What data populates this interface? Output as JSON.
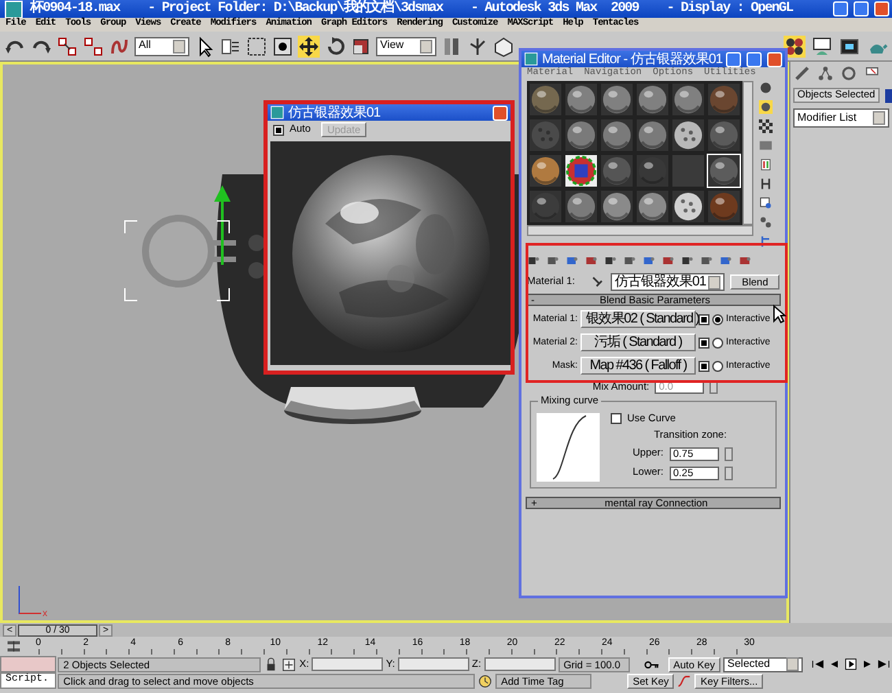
{
  "window": {
    "title": "杯0904-18.max    - Project Folder: D:\\Backup\\我的文档\\3dsmax    - Autodesk 3ds Max  2009    - Display : OpenGL"
  },
  "menu": [
    "File",
    "Edit",
    "Tools",
    "Group",
    "Views",
    "Create",
    "Modifiers",
    "Animation",
    "Graph Editors",
    "Rendering",
    "Customize",
    "MAXScript",
    "Help",
    "Tentacles"
  ],
  "toolbar": {
    "selection_filter": "All",
    "reference_coord": "View"
  },
  "viewport": {
    "axis_label": "x"
  },
  "command_panel": {
    "selection_field": "Objects Selected",
    "modifier_list": "Modifier List"
  },
  "preview": {
    "title": "仿古银器效果01",
    "auto_label": "Auto",
    "auto": true,
    "update": "Update",
    "update_disabled": true
  },
  "material_editor": {
    "title": "Material Editor - 仿古银器效果01",
    "menu": [
      "Material",
      "Navigation",
      "Options",
      "Utilities"
    ],
    "slots": [
      {
        "kind": "sphere",
        "color": "#75684f",
        "selected": false
      },
      {
        "kind": "sphere",
        "color": "#808080",
        "selected": false
      },
      {
        "kind": "sphere",
        "color": "#808080",
        "selected": false
      },
      {
        "kind": "sphere",
        "color": "#808080",
        "selected": false
      },
      {
        "kind": "sphere",
        "color": "#808080",
        "selected": false
      },
      {
        "kind": "sphere",
        "color": "#6a4630",
        "selected": false
      },
      {
        "kind": "pattern",
        "color": "#4a4a4a",
        "selected": false
      },
      {
        "kind": "sphere",
        "color": "#7a7a7a",
        "selected": false
      },
      {
        "kind": "sphere",
        "color": "#7a7a7a",
        "selected": false
      },
      {
        "kind": "sphere",
        "color": "#7a7a7a",
        "selected": false
      },
      {
        "kind": "pattern",
        "color": "#b8b8b8",
        "selected": false
      },
      {
        "kind": "sphere",
        "color": "#5a5a5a",
        "selected": false
      },
      {
        "kind": "sphere",
        "color": "#b07a40",
        "selected": false
      },
      {
        "kind": "multicolor",
        "color": "#c83030",
        "selected": false
      },
      {
        "kind": "sphere",
        "color": "#555555",
        "selected": false
      },
      {
        "kind": "sphere",
        "color": "#383838",
        "selected": false
      },
      {
        "kind": "flat",
        "color": "#3a3a3a",
        "selected": false
      },
      {
        "kind": "sphere",
        "color": "#5c5c5c",
        "selected": true
      },
      {
        "kind": "sphere",
        "color": "#3c3c3c",
        "selected": false
      },
      {
        "kind": "sphere",
        "color": "#7a7a7a",
        "selected": false
      },
      {
        "kind": "sphere",
        "color": "#8a8a8a",
        "selected": false
      },
      {
        "kind": "sphere",
        "color": "#8a8a8a",
        "selected": false
      },
      {
        "kind": "pattern",
        "color": "#d0d0d0",
        "selected": false
      },
      {
        "kind": "sphere",
        "color": "#6e3a1e",
        "selected": false
      }
    ],
    "material_label": "Material 1:",
    "material_name": "仿古银器效果01",
    "type_button": "Blend",
    "rollout": {
      "toggle": "-",
      "title": "Blend Basic Parameters",
      "rows": [
        {
          "label": "Material 1:",
          "value": "银效果02  ( Standard )",
          "enabled": true,
          "interactive": true,
          "interactive_label": "Interactive"
        },
        {
          "label": "Material 2:",
          "value": "污垢  ( Standard )",
          "enabled": true,
          "interactive": false,
          "interactive_label": "Interactive"
        },
        {
          "label": "Mask:",
          "value": "Map #436  ( Falloff )",
          "enabled": true,
          "interactive": false,
          "interactive_label": "Interactive"
        }
      ],
      "mix_amount_label": "Mix Amount:",
      "mix_amount": "0.0"
    },
    "mixing_curve": {
      "title": "Mixing curve",
      "use_curve_label": "Use Curve",
      "use_curve": false,
      "transition_label": "Transition zone:",
      "upper_label": "Upper:",
      "upper": "0.75",
      "lower_label": "Lower:",
      "lower": "0.25"
    },
    "rollout_2": {
      "toggle": "+",
      "title": "mental ray Connection"
    }
  },
  "timeline": {
    "prev": "<",
    "position": "0 / 30",
    "level": 0,
    "next": ">",
    "ticks": [
      "0",
      "2",
      "4",
      "6",
      "8",
      "10",
      "12",
      "14",
      "16",
      "18",
      "20",
      "22",
      "24",
      "26",
      "28",
      "30"
    ]
  },
  "status": {
    "listener": "Script.",
    "selection": "2 Objects Selected",
    "prompt": "Click and drag to select and move objects",
    "x_label": "X:",
    "y_label": "Y:",
    "z_label": "Z:",
    "grid": "Grid = 100.0",
    "time_tag": "Add Time Tag",
    "auto_key": "Auto Key",
    "key_mode": "Selected",
    "set_key": "Set Key",
    "key_filters": "Key Filters..."
  }
}
